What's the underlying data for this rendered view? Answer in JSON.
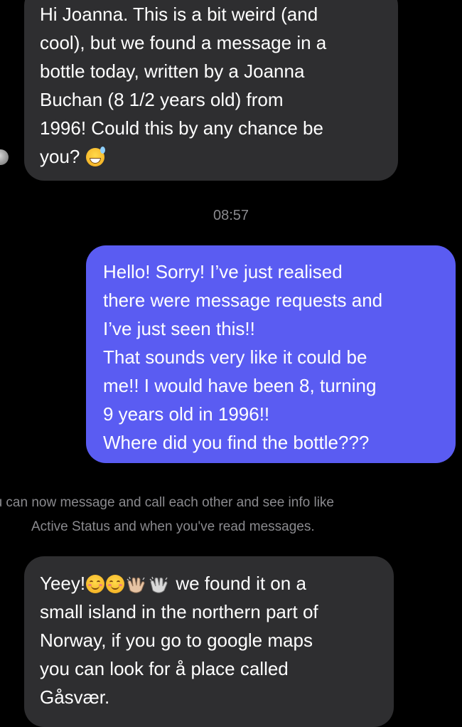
{
  "conversation": {
    "messages": [
      {
        "direction": "incoming",
        "lines": [
          "Hi Joanna. This is a bit weird (and",
          "cool), but we found a message in a",
          "bottle today, written by a Joanna",
          "Buchan (8 1/2 years old) from",
          "1996! Could this by any chance be",
          "you?"
        ],
        "emoji": "sweat-smile-emoji"
      },
      {
        "direction": "outgoing",
        "lines": [
          "Hello!  Sorry! I’ve just realised",
          "there were message requests and",
          "I’ve just seen this!!",
          "That sounds very like it could be",
          "me!! I would have been 8, turning",
          "9 years old in 1996!!",
          "Where did you find the bottle???"
        ]
      },
      {
        "direction": "incoming",
        "first_line_prefix": "Yeey!",
        "first_line_emojis": [
          "smiling-face-emoji",
          "smiling-face-emoji",
          "clapping-hands-emoji",
          "clapping-hands-emoji"
        ],
        "first_line_suffix": " we found it on a",
        "lines": [
          "small island in the northern part of",
          "Norway, if you go to google maps",
          "you can look for å place called",
          "Gåsvær."
        ]
      }
    ],
    "timestamp": "08:57",
    "system_notice": {
      "line1": "ou can now message and call each other and see info like",
      "line2": "Active Status and when you've read messages."
    }
  },
  "colors": {
    "background": "#000000",
    "incoming_bubble": "#2e2e30",
    "outgoing_bubble": "#5a5cf2",
    "meta_text": "#8a8a8e",
    "text": "#ffffff"
  }
}
